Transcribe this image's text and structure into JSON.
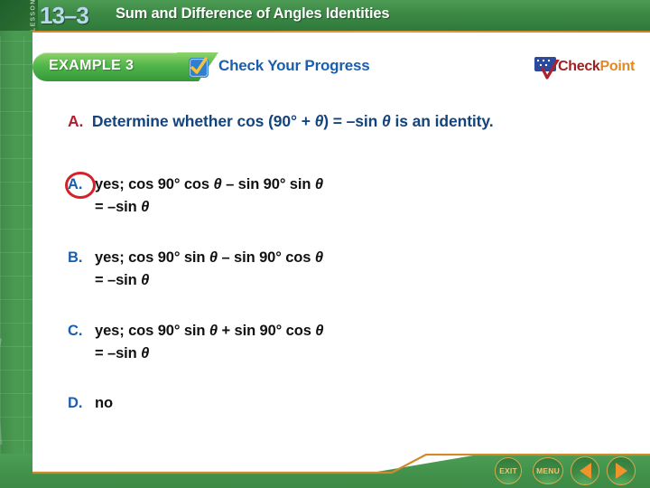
{
  "header": {
    "lesson_word": "LESSON",
    "lesson_number": "13–3",
    "title": "Sum and Difference of Angles Identities"
  },
  "example_band": {
    "example_label": "EXAMPLE 3",
    "check_icon": "checkbox-checked-icon",
    "check_progress_label": "Check Your Progress"
  },
  "checkpoint_logo": {
    "flag_icon": "flag-icon",
    "tick_icon": "checkmark-icon",
    "word_check": "Check",
    "word_point": "Point"
  },
  "question": {
    "label": "A.",
    "text_part1": "Determine whether cos (90° + ",
    "theta": "θ",
    "text_part2": ") = –sin ",
    "theta2": "θ",
    "text_part3": " is an identity."
  },
  "choices": [
    {
      "label": "A.",
      "line1_a": "yes; cos 90° cos ",
      "theta1": "θ",
      "line1_b": " – sin 90° sin ",
      "theta2": "θ",
      "line2_a": "= –sin ",
      "theta3": "θ",
      "selected": true
    },
    {
      "label": "B.",
      "line1_a": "yes; cos 90° sin ",
      "theta1": "θ",
      "line1_b": " – sin 90° cos ",
      "theta2": "θ",
      "line2_a": "= –sin ",
      "theta3": "θ",
      "selected": false
    },
    {
      "label": "C.",
      "line1_a": "yes; cos 90° sin ",
      "theta1": "θ",
      "line1_b": " + sin 90° cos ",
      "theta2": "θ",
      "line2_a": "= –sin ",
      "theta3": "θ",
      "selected": false
    },
    {
      "label": "D.",
      "line1_a": "no",
      "theta1": "",
      "line1_b": "",
      "theta2": "",
      "line2_a": "",
      "theta3": "",
      "selected": false
    }
  ],
  "footer": {
    "exit_label": "EXIT",
    "menu_label": "MENU",
    "back_icon": "arrow-left-icon",
    "forward_icon": "arrow-right-icon"
  },
  "colors": {
    "header_green": "#3d8a46",
    "accent_orange": "#d78a2a",
    "question_blue": "#13447e",
    "question_label_red": "#b02030",
    "choice_label_blue": "#1a5fae",
    "answer_ring_red": "#d4212a",
    "checkpoint_check_red": "#a02020",
    "checkpoint_point_orange": "#e08a22"
  }
}
